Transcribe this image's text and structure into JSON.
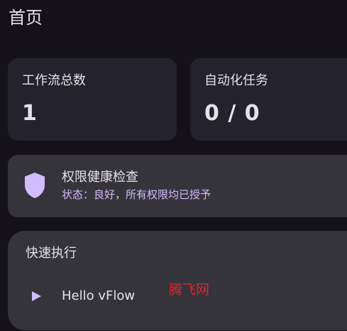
{
  "header": {
    "title": "首页"
  },
  "stats": {
    "workflows": {
      "label": "工作流总数",
      "value": "1"
    },
    "tasks": {
      "label": "自动化任务",
      "value": "0 / 0"
    }
  },
  "permission": {
    "icon": "shield-icon",
    "title": "权限健康检查",
    "status": "状态：良好，所有权限均已授予"
  },
  "quick_run": {
    "title": "快速执行",
    "items": [
      {
        "icon": "play-icon",
        "label": "Hello vFlow"
      }
    ]
  },
  "watermark": {
    "text": "腾飞网",
    "color": "#e0242f"
  },
  "colors": {
    "background": "#141218",
    "card": "#24222a",
    "card_raised": "#36343b",
    "accent": "#d0bcff",
    "text": "#e6e1e9"
  }
}
